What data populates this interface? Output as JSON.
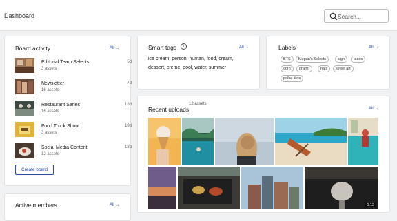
{
  "page_title": "Dashboard",
  "search": {
    "placeholder": "Search...",
    "icon": "magnifier"
  },
  "board_activity": {
    "title": "Board activity",
    "all_link": "All →",
    "boards": [
      {
        "name": "Editorial Team Selects",
        "count": "3 assets",
        "age": "5d"
      },
      {
        "name": "Newsletter",
        "count": "16 assets",
        "age": "7d"
      },
      {
        "name": "Restaurant Series",
        "count": "16 assets",
        "age": "18d"
      },
      {
        "name": "Food Truck Shoot",
        "count": "3 assets",
        "age": "18d"
      },
      {
        "name": "Social Media Content",
        "count": "12 assets",
        "age": "18d"
      }
    ],
    "create_label": "Create board"
  },
  "active_members": {
    "title": "Active members",
    "all_link": "All →"
  },
  "smart_tags": {
    "title": "Smart tags",
    "all_link": "All →",
    "text": "ice cream, person, human, food, cream, dessert, creme, pool, water, summer"
  },
  "labels": {
    "title": "Labels",
    "all_link": "All →",
    "items": [
      "BTS",
      "Megan's Selects",
      "sign",
      "tacos",
      "corn",
      "graffiti",
      "hats",
      "street art",
      "polka dots"
    ]
  },
  "recent_uploads": {
    "title": "Recent uploads",
    "count": "12 assets",
    "all_link": "All →",
    "video_duration": "0:13"
  },
  "colors": {
    "accent": "#2a4bb0",
    "border": "#e2e2e2",
    "background": "#f1f2f3"
  }
}
